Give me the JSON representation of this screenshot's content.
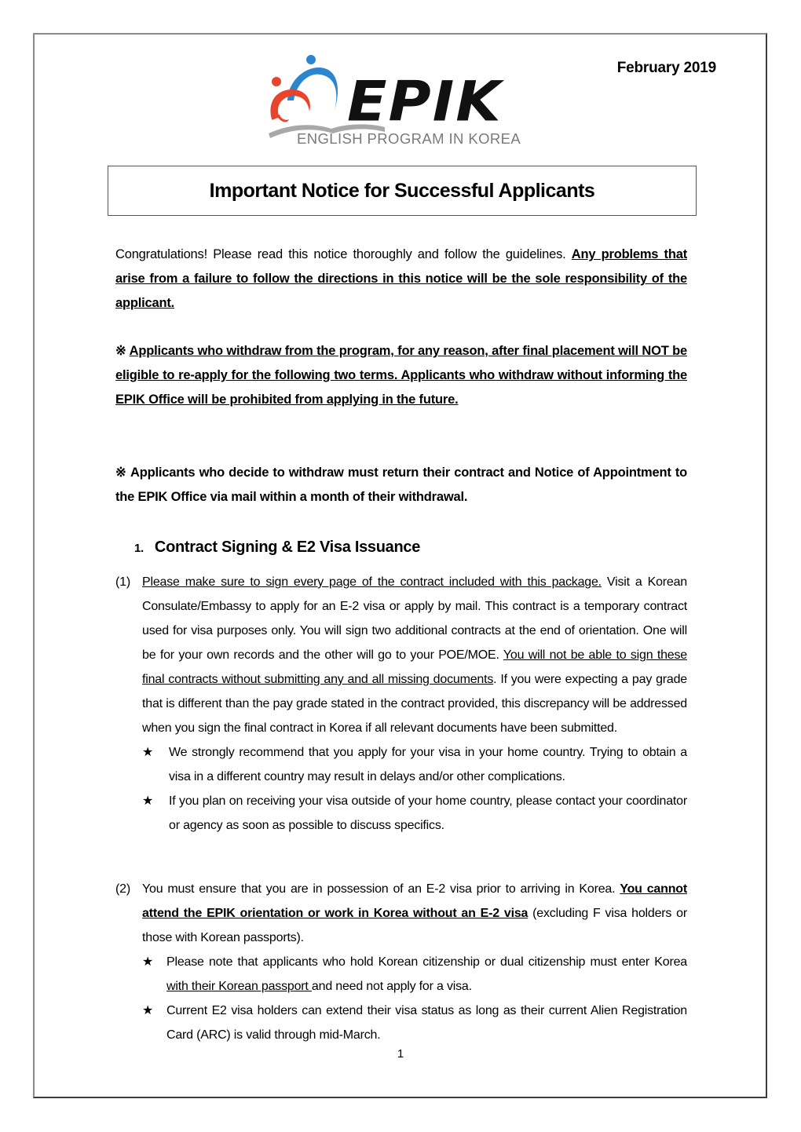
{
  "header": {
    "date": "February 2019",
    "logo": {
      "wordmark": "EPIK",
      "tagline": "ENGLISH PROGRAM IN KOREA",
      "colors": {
        "red": "#e8432b",
        "blue": "#2b86cf",
        "gray": "#a8a8a8",
        "ink": "#111111"
      }
    },
    "title": "Important Notice for Successful Applicants"
  },
  "intro": {
    "plain": "Congratulations! Please read this notice thoroughly and follow the guidelines. ",
    "emphasis": "Any problems that arise from a failure to follow the directions in this notice will be the sole responsibility of the applicant."
  },
  "notices": [
    {
      "symbol": "※",
      "text": "Applicants who withdraw from the program, for any reason, after final placement will NOT be eligible to re-apply for the following two terms. Applicants who withdraw without informing the EPIK Office will be prohibited from applying in the future."
    },
    {
      "symbol": "※",
      "text": "Applicants who decide to withdraw must return their contract and Notice of Appointment to the EPIK Office via mail within a month of their withdrawal."
    }
  ],
  "section1": {
    "number": "1.",
    "heading": "Contract Signing & E2 Visa Issuance",
    "items": [
      {
        "label": "(1)",
        "part1_underlined": "Please make sure to sign every page of the contract included with this package.",
        "part2": " Visit a Korean Consulate/Embassy to apply for an E-2 visa or apply by mail. This contract is a temporary contract used for visa purposes only. You will sign two additional contracts at the end of orientation. One will be for your own records and the other will go to your POE/MOE. ",
        "part3_underlined": "You will not be able to sign these final contracts without submitting any and all missing documents",
        "part4": ". If you were expecting a pay grade that is different than the pay grade stated in the contract provided, this discrepancy will be addressed when you sign the final contract in Korea if all relevant documents have been submitted.",
        "bullets": [
          "We strongly recommend that you apply for your visa in your home country. Trying to obtain a visa in a different country may result in delays and/or other complications.",
          "If you plan on receiving your visa outside of your home country, please contact your coordinator or agency as soon as possible to discuss specifics."
        ]
      },
      {
        "label": "(2)",
        "part1": "You must ensure that you are in possession of an E-2 visa prior to arriving in Korea. ",
        "part2_bold_underlined": "You cannot attend the EPIK orientation or work in Korea without an E-2 visa",
        "part3": " (excluding F visa holders or those with Korean passports).",
        "bullets": [
          {
            "before": "Please note that applicants who hold Korean citizenship or dual citizenship must enter Korea ",
            "underlined": "with their Korean passport ",
            "after": "and need not apply for a visa."
          },
          {
            "text": "Current E2 visa holders can extend their visa status as long as their current Alien Registration Card (ARC) is valid through mid-March."
          }
        ]
      }
    ],
    "bullet_symbol": "★"
  },
  "footer": {
    "page_number": "1"
  }
}
